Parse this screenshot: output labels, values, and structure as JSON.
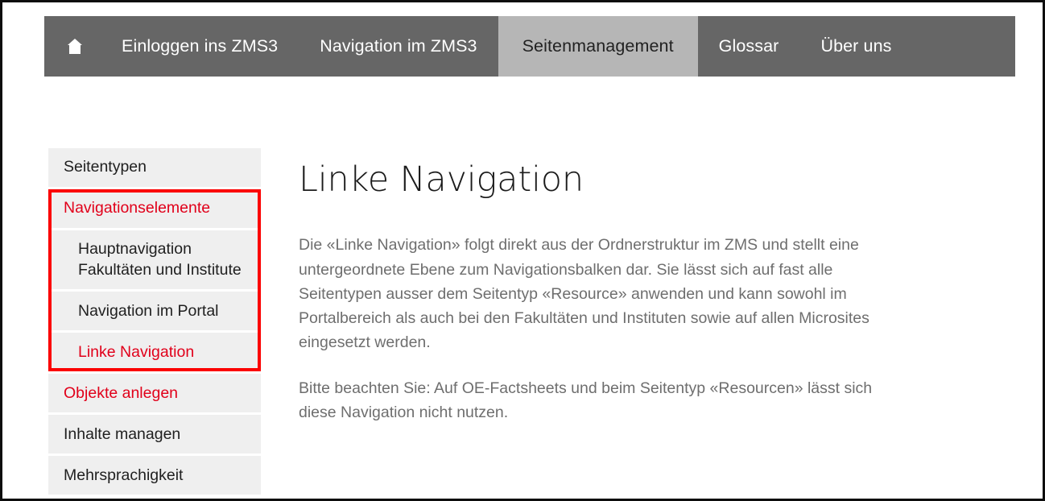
{
  "topnav": {
    "home_icon": "home-icon",
    "items": [
      {
        "label": "Einloggen ins ZMS3",
        "active": false
      },
      {
        "label": "Navigation im ZMS3",
        "active": false
      },
      {
        "label": "Seitenmanagement",
        "active": true
      },
      {
        "label": "Glossar",
        "active": false
      },
      {
        "label": "Über uns",
        "active": false
      }
    ]
  },
  "sidebar": {
    "items": [
      {
        "label": "Seitentypen",
        "link": false,
        "sub": false
      },
      {
        "label": "Navigationselemente",
        "link": true,
        "sub": false
      },
      {
        "label": "Hauptnavigation Fakultäten und Institute",
        "link": false,
        "sub": true
      },
      {
        "label": "Navigation im Portal",
        "link": false,
        "sub": true
      },
      {
        "label": "Linke Navigation",
        "link": true,
        "sub": true
      },
      {
        "label": "Objekte anlegen",
        "link": true,
        "sub": false
      },
      {
        "label": "Inhalte managen",
        "link": false,
        "sub": false
      },
      {
        "label": "Mehrsprachigkeit",
        "link": false,
        "sub": false
      }
    ]
  },
  "main": {
    "title": "Linke Navigation",
    "paragraphs": [
      "Die «Linke Navigation» folgt direkt aus der Ordnerstruktur im ZMS und stellt eine untergeordnete Ebene zum Navigationsbalken dar. Sie lässt sich auf fast alle Seitentypen ausser dem Seitentyp «Resource» anwenden und kann sowohl im Portalbereich als auch bei den Fakultäten und Instituten sowie auf allen Microsites eingesetzt werden.",
      "Bitte beachten Sie: Auf OE-Factsheets und beim Seitentyp «Resourcen» lässt sich diese Navigation nicht nutzen."
    ]
  },
  "colors": {
    "nav_background": "#666666",
    "nav_active_background": "#b6b6b6",
    "link_red": "#e1001a",
    "annotation_red": "#fb0000",
    "sidebar_item_background": "#efefef",
    "body_text": "#6e6e6e"
  }
}
